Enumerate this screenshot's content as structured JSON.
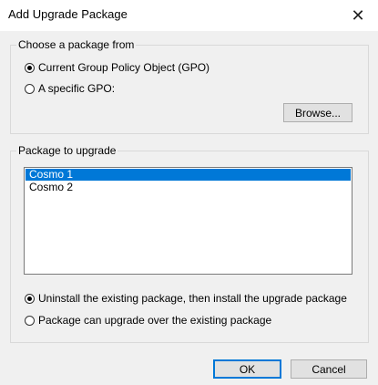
{
  "window": {
    "title": "Add Upgrade Package"
  },
  "icons": {
    "close": "close-icon"
  },
  "source_group": {
    "label": "Choose a package from",
    "options": [
      {
        "label": "Current Group Policy Object (GPO)",
        "checked": true
      },
      {
        "label": "A specific GPO:",
        "checked": false
      }
    ],
    "browse_label": "Browse..."
  },
  "package_group": {
    "label": "Package to upgrade",
    "items": [
      {
        "label": "Cosmo 1",
        "selected": true
      },
      {
        "label": "Cosmo 2",
        "selected": false
      }
    ],
    "options": [
      {
        "label": "Uninstall the existing package, then install the upgrade package",
        "checked": true
      },
      {
        "label": "Package can upgrade over the existing package",
        "checked": false
      }
    ]
  },
  "buttons": {
    "ok": "OK",
    "cancel": "Cancel"
  },
  "colors": {
    "selection": "#0078d7",
    "background": "#f0f0f0"
  }
}
